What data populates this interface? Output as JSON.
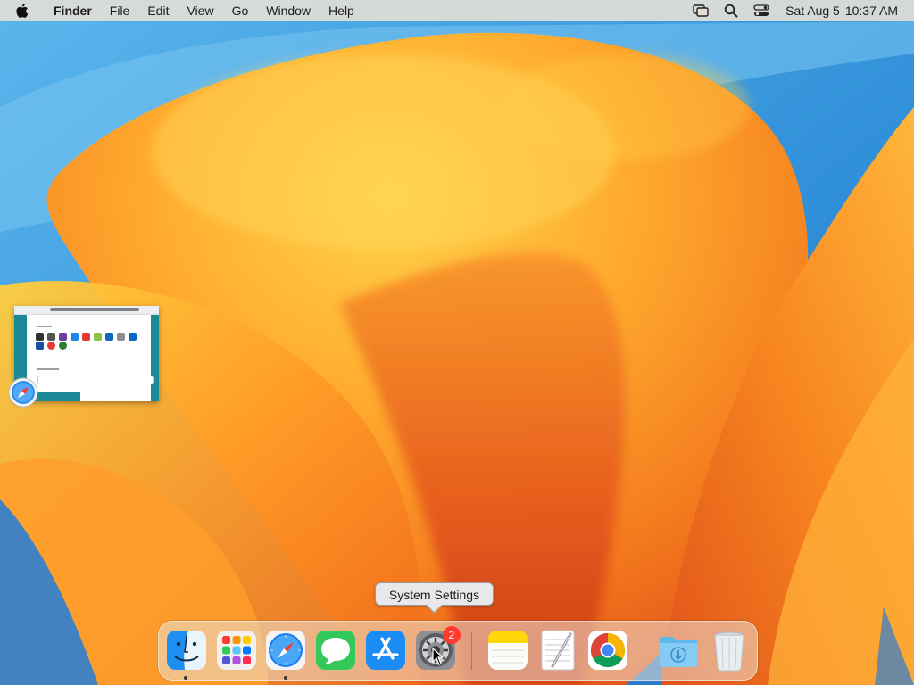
{
  "menubar": {
    "apple_icon": "apple-logo-icon",
    "app_name": "Finder",
    "menus": [
      "File",
      "Edit",
      "View",
      "Go",
      "Window",
      "Help"
    ],
    "status_icons": [
      "screen-mirroring-icon",
      "spotlight-search-icon",
      "control-center-icon"
    ],
    "date": "Sat Aug 5",
    "time": "10:37 AM"
  },
  "minimized_window": {
    "app": "Safari",
    "badge_icon": "safari-icon"
  },
  "tooltip": {
    "text": "System Settings"
  },
  "dock": {
    "items": [
      {
        "name": "Finder",
        "icon": "finder-icon",
        "running": true
      },
      {
        "name": "Launchpad",
        "icon": "launchpad-icon",
        "running": false
      },
      {
        "name": "Safari",
        "icon": "safari-icon",
        "running": true
      },
      {
        "name": "Messages",
        "icon": "messages-icon",
        "running": false
      },
      {
        "name": "App Store",
        "icon": "app-store-icon",
        "running": false
      },
      {
        "name": "System Settings",
        "icon": "system-settings-icon",
        "running": false,
        "badge": "2"
      },
      {
        "name": "Notes",
        "icon": "notes-icon",
        "running": false
      },
      {
        "name": "TextEdit",
        "icon": "textedit-icon",
        "running": false
      },
      {
        "name": "Google Chrome",
        "icon": "chrome-icon",
        "running": false
      },
      {
        "name": "Downloads",
        "icon": "downloads-folder-icon",
        "running": false
      },
      {
        "name": "Trash",
        "icon": "trash-icon",
        "running": false
      }
    ]
  },
  "colors": {
    "wallpaper_orange": "#f08a1c",
    "wallpaper_yellow": "#ffc93c",
    "wallpaper_red": "#d9401a",
    "wallpaper_blue": "#3f8fd6",
    "badge_red": "#ff3b30"
  }
}
